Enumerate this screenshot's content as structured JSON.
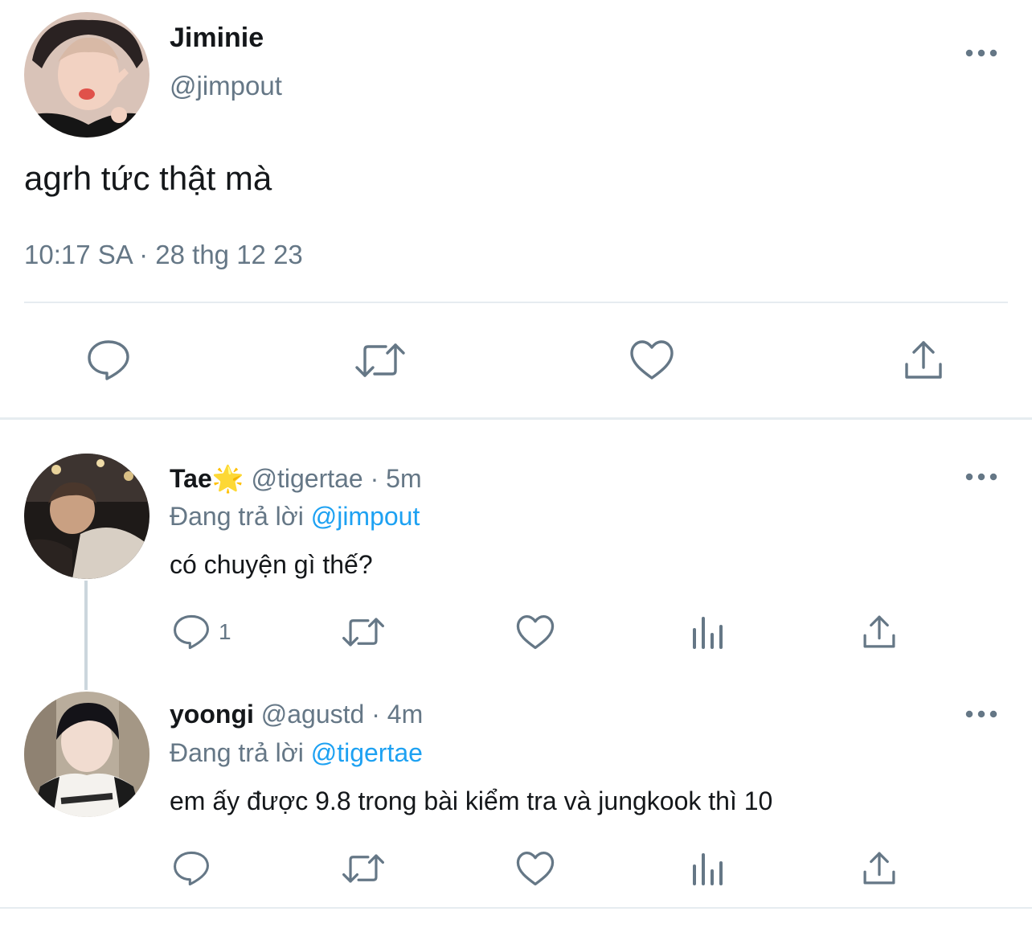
{
  "main_tweet": {
    "name": "Jiminie",
    "handle": "@jimpout",
    "text": "agrh tức thật mà",
    "meta": "10:17 SA · 28 thg 12 23",
    "actions": [
      "reply-icon",
      "retweet-icon",
      "like-icon",
      "share-icon"
    ]
  },
  "replies": [
    {
      "name": "Tae",
      "badge": "🌟",
      "handle": "@tigertae",
      "sep": " · ",
      "time": "5m",
      "replying_label": "Đang trả lời ",
      "replying_to": "@jimpout",
      "text": "có chuyện gì thế?",
      "reply_count": "1"
    },
    {
      "name": "yoongi",
      "badge": "",
      "handle": "@agustd",
      "sep": " · ",
      "time": "4m",
      "replying_label": "Đang trả lời ",
      "replying_to": "@tigertae",
      "text": "em ấy được 9.8 trong bài kiểm tra và jungkook thì 10",
      "reply_count": ""
    }
  ],
  "colors": {
    "text": "#14171a",
    "muted": "#657786",
    "link": "#1da1f2",
    "divider": "#e6ecf0"
  }
}
